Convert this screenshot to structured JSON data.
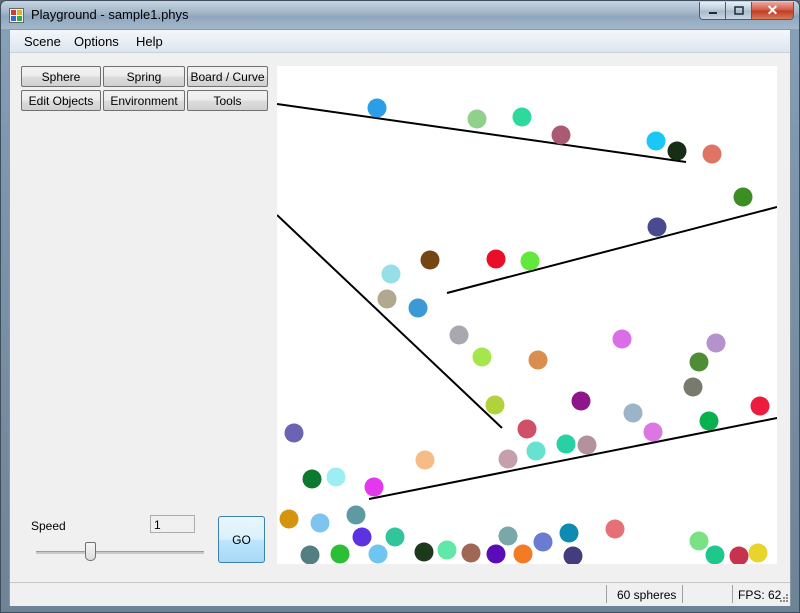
{
  "window": {
    "title": "Playground - sample1.phys",
    "close_glyph": "✕"
  },
  "menu": {
    "scene": "Scene",
    "options": "Options",
    "help": "Help"
  },
  "toolbar": {
    "sphere": "Sphere",
    "spring": "Spring",
    "board_curve": "Board / Curve",
    "edit_objects": "Edit Objects",
    "environment": "Environment",
    "tools": "Tools"
  },
  "speed": {
    "label": "Speed",
    "value": "1",
    "slider_min": 0,
    "slider_max": 10,
    "slider_value": 3
  },
  "go_label": "GO",
  "status": {
    "spheres": "60 spheres",
    "fps": "FPS: 62"
  },
  "colors": {
    "canvas_bg": "#ffffff",
    "board_line": "#000000",
    "go_button_border": "#3c7fb1"
  },
  "icons": {
    "app": "app-icon",
    "minimize": "minimize-icon",
    "maximize": "maximize-icon",
    "close": "close-icon",
    "resize_grip": "resize-grip-icon"
  }
}
